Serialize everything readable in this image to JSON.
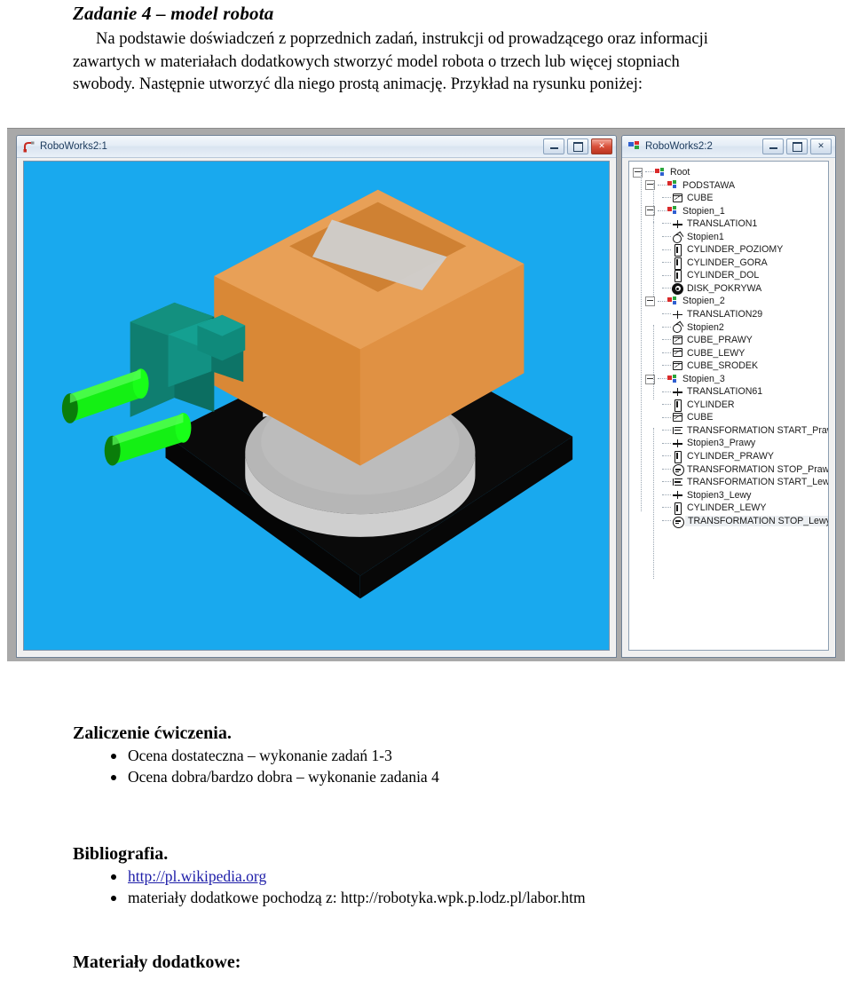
{
  "document": {
    "heading": "Zadanie 4 – model robota",
    "paragraph": "Na podstawie doświadczeń z poprzednich zadań, instrukcji od prowadzącego oraz informacji zawartych w materiałach dodatkowych stworzyć model robota o trzech lub więcej stopniach swobody. Następnie utworzyć dla niego prostą animację. Przykład na rysunku poniżej:"
  },
  "figure": {
    "viewer_window": {
      "title": "RoboWorks2:1",
      "icon": "robot-arm-icon",
      "buttons": {
        "minimize": "minimize",
        "maximize": "maximize",
        "close": "close"
      },
      "scene": {
        "background_color": "#19a9ee",
        "base_plate_color": "#000000",
        "disk_color": "#b9b9b9",
        "column_color": "#d2d2d2",
        "body_color": "#e08e3c",
        "joint_color": "#0e7f6f",
        "gripper_color": "#13f013"
      }
    },
    "tree_window": {
      "title": "RoboWorks2:2",
      "icon": "scene-tree-icon",
      "buttons": {
        "minimize": "minimize",
        "maximize": "maximize",
        "close": "close"
      },
      "nodes": [
        {
          "label": "Root",
          "depth": 0,
          "icon": "group-icon",
          "toggle": "expanded",
          "selected": false
        },
        {
          "label": "PODSTAWA",
          "depth": 1,
          "icon": "group-icon",
          "toggle": "expanded",
          "selected": false
        },
        {
          "label": "CUBE",
          "depth": 2,
          "icon": "cube-icon",
          "toggle": "none",
          "selected": false
        },
        {
          "label": "Stopien_1",
          "depth": 1,
          "icon": "group-icon",
          "toggle": "expanded",
          "selected": false
        },
        {
          "label": "TRANSLATION1",
          "depth": 2,
          "icon": "translate-icon",
          "toggle": "none",
          "selected": false
        },
        {
          "label": "Stopien1",
          "depth": 2,
          "icon": "rotate-icon",
          "toggle": "none",
          "selected": false
        },
        {
          "label": "CYLINDER_POZIOMY",
          "depth": 2,
          "icon": "cylinder-icon",
          "toggle": "none",
          "selected": false
        },
        {
          "label": "CYLINDER_GORA",
          "depth": 2,
          "icon": "cylinder-icon",
          "toggle": "none",
          "selected": false
        },
        {
          "label": "CYLINDER_DOL",
          "depth": 2,
          "icon": "cylinder-icon",
          "toggle": "none",
          "selected": false
        },
        {
          "label": "DISK_POKRYWA",
          "depth": 2,
          "icon": "disk-icon",
          "toggle": "none",
          "selected": false
        },
        {
          "label": "Stopien_2",
          "depth": 1,
          "icon": "group-icon",
          "toggle": "expanded",
          "selected": false
        },
        {
          "label": "TRANSLATION29",
          "depth": 2,
          "icon": "translate-icon",
          "toggle": "none",
          "selected": false
        },
        {
          "label": "Stopien2",
          "depth": 2,
          "icon": "rotate-icon",
          "toggle": "none",
          "selected": false
        },
        {
          "label": "CUBE_PRAWY",
          "depth": 2,
          "icon": "cube-icon",
          "toggle": "none",
          "selected": false
        },
        {
          "label": "CUBE_LEWY",
          "depth": 2,
          "icon": "cube-icon",
          "toggle": "none",
          "selected": false
        },
        {
          "label": "CUBE_SRODEK",
          "depth": 2,
          "icon": "cube-icon",
          "toggle": "none",
          "selected": false
        },
        {
          "label": "Stopien_3",
          "depth": 1,
          "icon": "group-icon",
          "toggle": "expanded",
          "selected": false
        },
        {
          "label": "TRANSLATION61",
          "depth": 2,
          "icon": "translate-icon",
          "toggle": "none",
          "selected": false
        },
        {
          "label": "CYLINDER",
          "depth": 2,
          "icon": "cylinder-icon",
          "toggle": "none",
          "selected": false
        },
        {
          "label": "CUBE",
          "depth": 2,
          "icon": "cube-icon",
          "toggle": "none",
          "selected": false
        },
        {
          "label": "TRANSFORMATION START_Prawy",
          "depth": 2,
          "icon": "start-icon",
          "toggle": "none",
          "selected": false
        },
        {
          "label": "Stopien3_Prawy",
          "depth": 2,
          "icon": "translate-icon",
          "toggle": "none",
          "selected": false
        },
        {
          "label": "CYLINDER_PRAWY",
          "depth": 2,
          "icon": "cylinder-icon",
          "toggle": "none",
          "selected": false
        },
        {
          "label": "TRANSFORMATION STOP_Prawy",
          "depth": 2,
          "icon": "stop-icon",
          "toggle": "none",
          "selected": false
        },
        {
          "label": "TRANSFORMATION START_Lewy",
          "depth": 2,
          "icon": "start-icon",
          "toggle": "none",
          "selected": false
        },
        {
          "label": "Stopien3_Lewy",
          "depth": 2,
          "icon": "translate-icon",
          "toggle": "none",
          "selected": false
        },
        {
          "label": "CYLINDER_LEWY",
          "depth": 2,
          "icon": "cylinder-icon",
          "toggle": "none",
          "selected": false
        },
        {
          "label": "TRANSFORMATION STOP_Lewy",
          "depth": 2,
          "icon": "stop-icon",
          "toggle": "none",
          "selected": true
        }
      ]
    }
  },
  "sections": {
    "zaliczenie": {
      "heading": "Zaliczenie ćwiczenia.",
      "items": [
        "Ocena dostateczna – wykonanie zadań 1-3",
        "Ocena dobra/bardzo dobra – wykonanie zadania 4"
      ]
    },
    "bibliografia": {
      "heading": "Bibliografia.",
      "items": [
        {
          "text": "http://pl.wikipedia.org",
          "link": true
        },
        {
          "text": "materiały dodatkowe pochodzą z: http://robotyka.wpk.p.lodz.pl/labor.htm",
          "link": false
        }
      ]
    },
    "materialy": {
      "heading": "Materiały dodatkowe:"
    }
  }
}
